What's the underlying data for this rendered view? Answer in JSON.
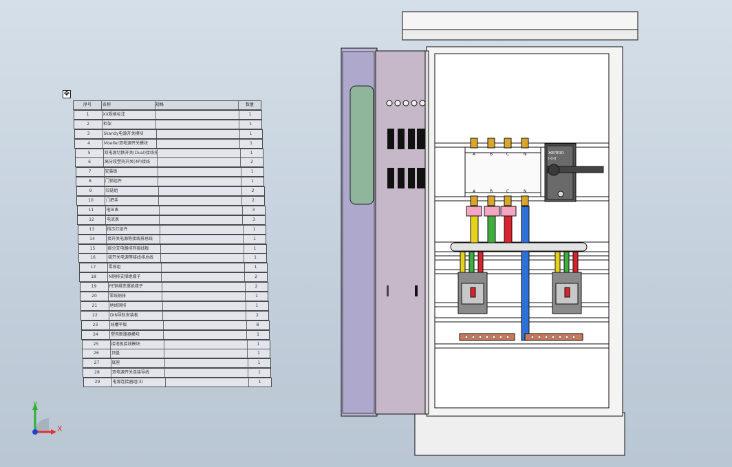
{
  "bom_table": {
    "header": [
      "序号",
      "名称",
      "规格",
      "数量"
    ],
    "rows": [
      {
        "no": "1",
        "name": "XX规格标注",
        "spec": "",
        "qty": "1"
      },
      {
        "no": "2",
        "name": "柜架",
        "spec": "",
        "qty": "1"
      },
      {
        "no": "3",
        "name": "Skandy电源开关模块",
        "spec": "",
        "qty": "1"
      },
      {
        "no": "4",
        "name": "Moeller双电源开关模块",
        "spec": "",
        "qty": "1"
      },
      {
        "no": "5",
        "name": "双电源切换开关(Dual)接线排",
        "spec": "",
        "qty": "1"
      },
      {
        "no": "6",
        "name": "高分段塑壳开关(4P)接线",
        "spec": "",
        "qty": "2"
      },
      {
        "no": "7",
        "name": "安装板",
        "spec": "",
        "qty": "1"
      },
      {
        "no": "8",
        "name": "门锁组件",
        "spec": "",
        "qty": "1"
      },
      {
        "no": "9",
        "name": "铰链组",
        "spec": "",
        "qty": "2"
      },
      {
        "no": "10",
        "name": "门把手",
        "spec": "",
        "qty": "2"
      },
      {
        "no": "11",
        "name": "电压表",
        "spec": "",
        "qty": "3"
      },
      {
        "no": "12",
        "name": "电流表",
        "spec": "",
        "qty": "3"
      },
      {
        "no": "13",
        "name": "指示灯组件",
        "spec": "",
        "qty": "1"
      },
      {
        "no": "14",
        "name": "接开关电源等接线排总线",
        "spec": "",
        "qty": "1"
      },
      {
        "no": "15",
        "name": "接分支电路排列接线板",
        "spec": "",
        "qty": "1"
      },
      {
        "no": "16",
        "name": "接开关电源等接线排总线",
        "spec": "",
        "qty": "1"
      },
      {
        "no": "17",
        "name": "零排组",
        "spec": "",
        "qty": "1"
      },
      {
        "no": "18",
        "name": "N铜排支撑绝缘子",
        "spec": "",
        "qty": "2"
      },
      {
        "no": "19",
        "name": "PE铜排支撑绝缘子",
        "spec": "",
        "qty": "2"
      },
      {
        "no": "20",
        "name": "零线铜排",
        "spec": "",
        "qty": "1"
      },
      {
        "no": "21",
        "name": "地线铜排",
        "spec": "",
        "qty": "1"
      },
      {
        "no": "22",
        "name": "DIN导轨安装板",
        "spec": "",
        "qty": "2"
      },
      {
        "no": "23",
        "name": "线槽平板",
        "spec": "",
        "qty": "8"
      },
      {
        "no": "24",
        "name": "塑壳断路器模块",
        "spec": "",
        "qty": "1"
      },
      {
        "no": "25",
        "name": "接地极接线模块",
        "spec": "",
        "qty": "1"
      },
      {
        "no": "26",
        "name": "顶盖",
        "spec": "",
        "qty": "1"
      },
      {
        "no": "27",
        "name": "底座",
        "spec": "",
        "qty": "1"
      },
      {
        "no": "28",
        "name": "双电源开关连接导线",
        "spec": "",
        "qty": "1"
      },
      {
        "no": "29",
        "name": "电源连接器组(3)",
        "spec": "",
        "qty": "1"
      }
    ]
  },
  "switch_labels": [
    "A",
    "B",
    "C",
    "N"
  ],
  "handle_labels": [
    "ЖЕЛЕЗО",
    "I-0-II"
  ],
  "triad": {
    "x_label": "X",
    "y_label": "Y"
  },
  "colors": {
    "phase_a": "#e6d21a",
    "phase_b": "#3fae3f",
    "phase_c": "#d9232e",
    "neutral": "#2f6fd8",
    "copper": "#c9795a",
    "cabinet": "#f2f2f2",
    "door_purple": "#b9b4d2",
    "door_window": "#8fb59a"
  }
}
